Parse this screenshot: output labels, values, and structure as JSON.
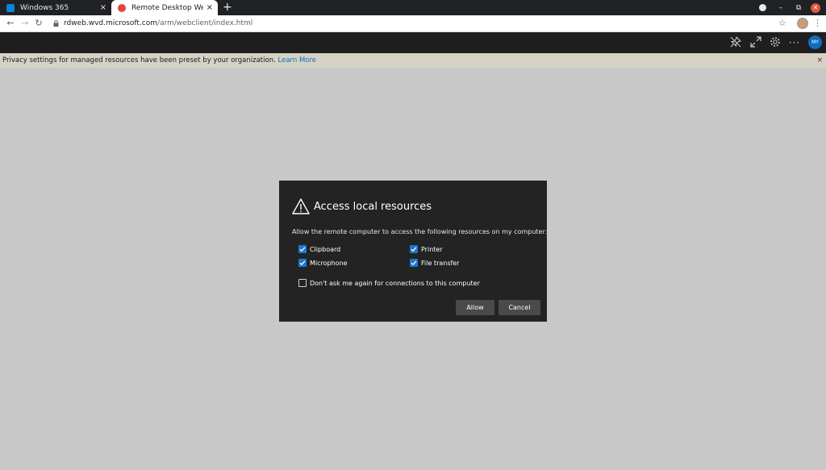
{
  "browser": {
    "tabs": [
      {
        "title": "Windows 365",
        "close": "×"
      },
      {
        "title": "Remote Desktop Web Client",
        "close": "×"
      }
    ],
    "new_tab": "+",
    "window_controls": {
      "minimize": "–",
      "restore": "⧉",
      "close": "✕"
    },
    "address": {
      "host": "rdweb.wvd.microsoft.com",
      "path": "/arm/webclient/index.html"
    }
  },
  "rd_toolbar": {
    "avatar_initials": "MY",
    "icons": [
      "pin-icon",
      "fullscreen-icon",
      "gear-icon",
      "more-icon"
    ]
  },
  "banner": {
    "text": "Privacy settings for managed resources have been preset by your organization.",
    "link": "Learn More",
    "close": "×"
  },
  "dialog": {
    "title": "Access local resources",
    "description": "Allow the remote computer to access the following resources on my computer:",
    "options": [
      {
        "label": "Clipboard",
        "checked": true
      },
      {
        "label": "Printer",
        "checked": true
      },
      {
        "label": "Microphone",
        "checked": true
      },
      {
        "label": "File transfer",
        "checked": true
      }
    ],
    "dont_ask": {
      "label": "Don't ask me again for connections to this computer",
      "checked": false
    },
    "allow_label": "Allow",
    "cancel_label": "Cancel"
  },
  "colors": {
    "accent": "#1b78d0",
    "dialog_bg": "#232323",
    "page_bg": "#c8c8c8",
    "banner_bg": "#d6d3c6"
  }
}
